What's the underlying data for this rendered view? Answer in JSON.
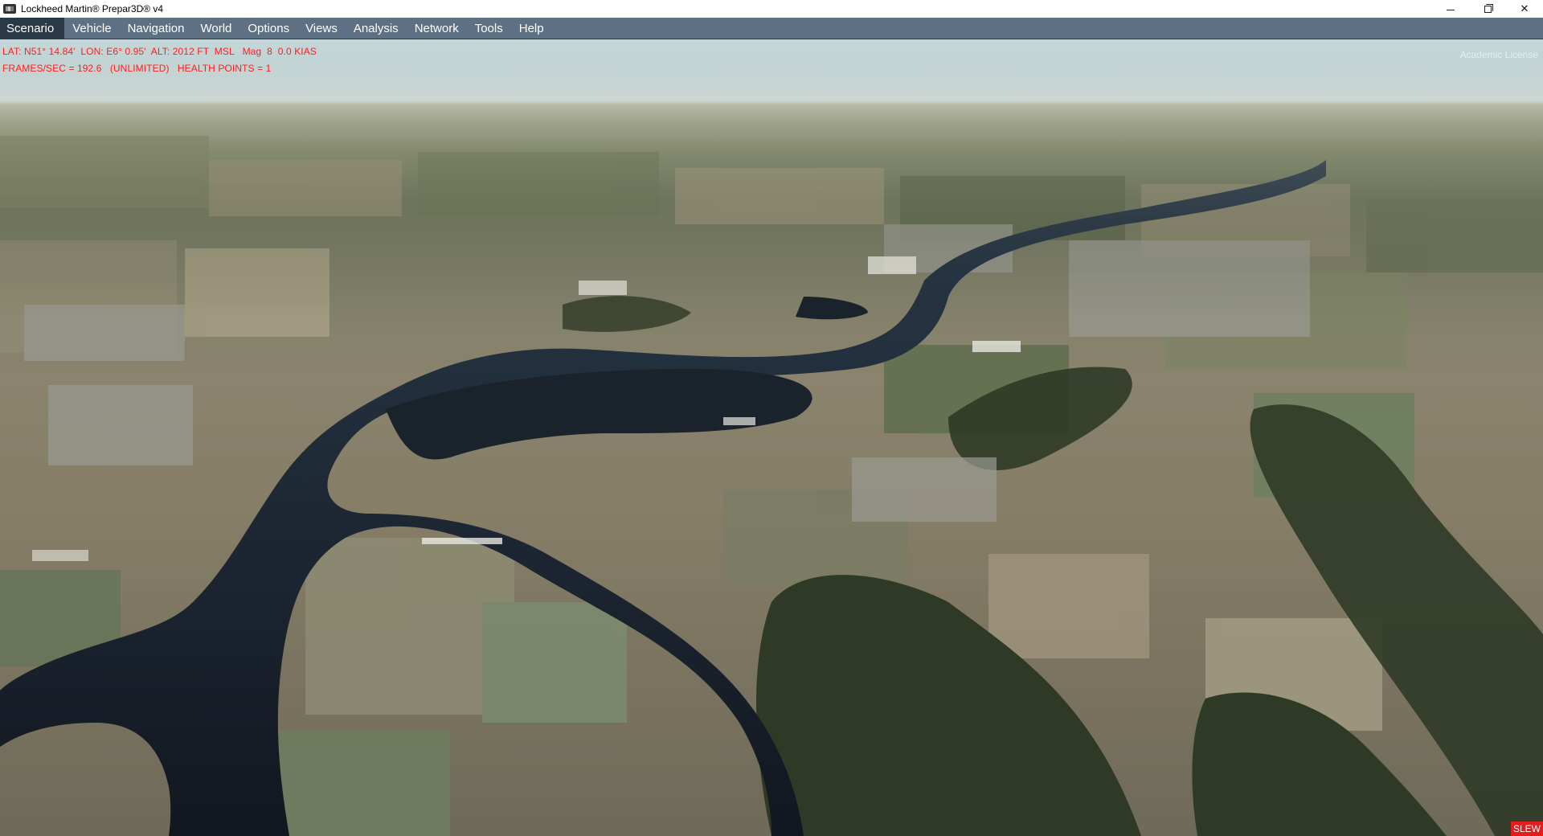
{
  "window": {
    "title": "Lockheed Martin® Prepar3D® v4",
    "controls": {
      "minimize": "",
      "maximize": "",
      "close": "✕"
    }
  },
  "menu": {
    "items": [
      {
        "label": "Scenario",
        "active": true
      },
      {
        "label": "Vehicle"
      },
      {
        "label": "Navigation"
      },
      {
        "label": "World"
      },
      {
        "label": "Options"
      },
      {
        "label": "Views"
      },
      {
        "label": "Analysis"
      },
      {
        "label": "Network"
      },
      {
        "label": "Tools"
      },
      {
        "label": "Help"
      }
    ]
  },
  "hud": {
    "line1": "LAT: N51° 14.84'  LON: E6° 0.95'  ALT: 2012 FT  MSL   Mag  8  0.0 KIAS",
    "line2": "FRAMES/SEC = 192.6   (UNLIMITED)   HEALTH POINTS = 1",
    "color": "#ff1d1d"
  },
  "license_text": "Academic License",
  "slew_badge": "SLEW",
  "scene": {
    "description_icon": "aerial-terrain-view"
  }
}
